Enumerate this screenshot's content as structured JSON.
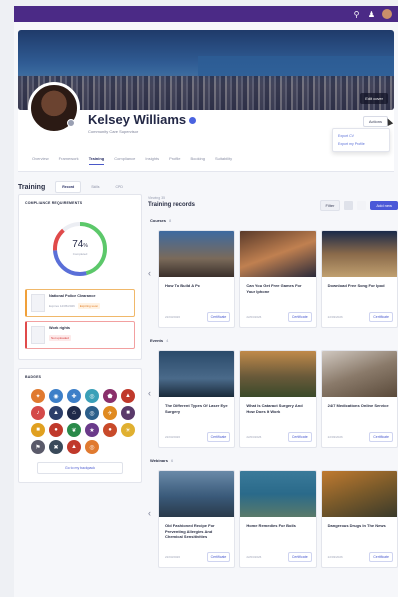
{
  "topbar": {
    "icons": [
      "search-icon",
      "users-icon"
    ]
  },
  "cover": {
    "edit_label": "Edit cover"
  },
  "profile": {
    "name": "Kelsey Williams",
    "subtitle": "Community Care Supervisor",
    "actions_label": "Actions",
    "actions_menu": [
      "Export CV",
      "Export my Profile"
    ],
    "tabs": [
      "Overview",
      "Framework",
      "Training",
      "Compliance",
      "Insights",
      "Profile",
      "Booking",
      "Suitability"
    ],
    "active_tab": "Training"
  },
  "training": {
    "title": "Training",
    "tabs": [
      "Record",
      "Skills",
      "CPD"
    ],
    "active_tab": "Record"
  },
  "compliance": {
    "title": "COMPLIANCE REQUIREMENTS",
    "percent": "74",
    "percent_sign": "%",
    "percent_label": "Completed",
    "ring_fraction": 0.74,
    "colors": {
      "done": "#5cc86a",
      "pending": "#5a6fd8",
      "expired": "#e04a4a"
    },
    "items": [
      {
        "title": "National Police Clearance",
        "date": "Expires 12/05/2026",
        "tag": "Expiring soon",
        "status": "expiring"
      },
      {
        "title": "Work rights",
        "date": "",
        "tag": "Not uploaded",
        "status": "missing"
      }
    ]
  },
  "badges": {
    "title": "BADGES",
    "items": [
      {
        "icon": "compass-icon",
        "color": "#e07a30"
      },
      {
        "icon": "globe-icon",
        "color": "#3d7fc8"
      },
      {
        "icon": "wrench-icon",
        "color": "#3d7fc8"
      },
      {
        "icon": "bike-icon",
        "color": "#3aa0b8"
      },
      {
        "icon": "shield-icon",
        "color": "#8a2f6a"
      },
      {
        "icon": "flame-icon",
        "color": "#c0392b"
      },
      {
        "icon": "music-icon",
        "color": "#d44a4a"
      },
      {
        "icon": "mountain-icon",
        "color": "#2c3e6a"
      },
      {
        "icon": "tent-icon",
        "color": "#1f2a4a"
      },
      {
        "icon": "bicycle-icon",
        "color": "#2c5f8a"
      },
      {
        "icon": "plane-icon",
        "color": "#e08a20"
      },
      {
        "icon": "car-icon",
        "color": "#5a3a6a"
      },
      {
        "icon": "bus-icon",
        "color": "#e0a020"
      },
      {
        "icon": "lock-icon",
        "color": "#c0392b"
      },
      {
        "icon": "leaf-icon",
        "color": "#2a8a4a"
      },
      {
        "icon": "star-icon",
        "color": "#6a3a8a"
      },
      {
        "icon": "pin-icon",
        "color": "#c84a2a"
      },
      {
        "icon": "sun-icon",
        "color": "#e0b030"
      },
      {
        "icon": "flag-icon",
        "color": "#5a5a6a"
      },
      {
        "icon": "tools-icon",
        "color": "#3a4a5a"
      },
      {
        "icon": "rocket-icon",
        "color": "#c0392b"
      },
      {
        "icon": "target-icon",
        "color": "#e07a30"
      }
    ],
    "backpack_label": "Go to my backpack"
  },
  "records": {
    "viewing": "Viewing",
    "viewing_count": "35",
    "title": "Training records",
    "filter_label": "Filter",
    "add_label": "Add new",
    "sections": [
      {
        "name": "Courses",
        "count": "8",
        "items": [
          {
            "title": "How To Build A Pc",
            "date": "22/03/2026",
            "cert": "Certificate"
          },
          {
            "title": "Can You Get Free Games For Your Iphone",
            "date": "22/03/2026",
            "cert": "Certificate"
          },
          {
            "title": "Download Free Song For Ipod",
            "date": "22/03/2026",
            "cert": "Certificate"
          }
        ]
      },
      {
        "name": "Events",
        "count": "4",
        "items": [
          {
            "title": "The Different Types Of Laser Eye Surgery",
            "date": "22/03/2026",
            "cert": "Certificate"
          },
          {
            "title": "What Is Cataract Surgery And How Does It Work",
            "date": "22/03/2026",
            "cert": "Certificate"
          },
          {
            "title": "24/7 Medications Online Service",
            "date": "22/03/2026",
            "cert": "Certificate"
          }
        ]
      },
      {
        "name": "Webinars",
        "count": "6",
        "items": [
          {
            "title": "Old Fashioned Recipe For Preventing Allergies And Chemical Sensitivities",
            "date": "22/03/2026",
            "cert": "Certificate"
          },
          {
            "title": "Home Remedies For Boils",
            "date": "22/03/2026",
            "cert": "Certificate"
          },
          {
            "title": "Dangerous Drugs In The News",
            "date": "22/03/2026",
            "cert": "Certificate"
          }
        ]
      }
    ]
  }
}
